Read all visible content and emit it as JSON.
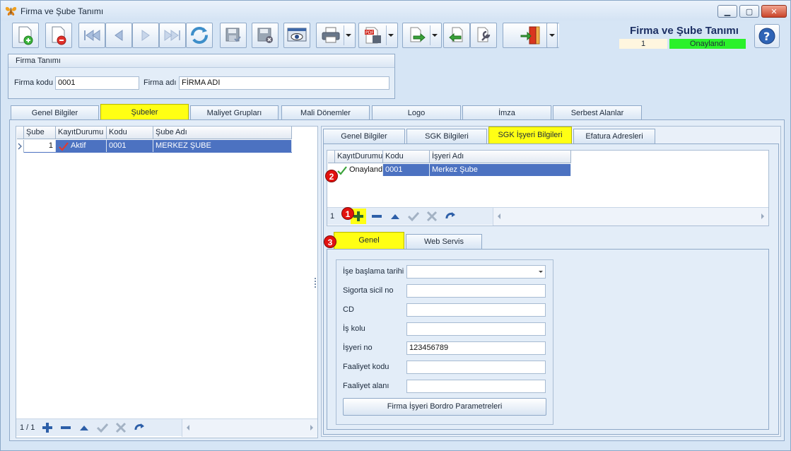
{
  "window": {
    "title": "Firma ve Şube Tanımı",
    "controls": {
      "minimize": "▭",
      "maximize": "▭",
      "close": "✕"
    }
  },
  "toolbar": {
    "buttons": [
      {
        "id": "new",
        "icon": "new-document-icon"
      },
      {
        "id": "delete",
        "icon": "delete-document-icon"
      },
      {
        "id": "first",
        "icon": "first-record-icon"
      },
      {
        "id": "prev",
        "icon": "previous-record-icon"
      },
      {
        "id": "next",
        "icon": "next-record-icon"
      },
      {
        "id": "last",
        "icon": "last-record-icon"
      },
      {
        "id": "refresh",
        "icon": "refresh-icon"
      },
      {
        "id": "save",
        "icon": "save-icon"
      },
      {
        "id": "cancel-save",
        "icon": "save-cancel-icon"
      },
      {
        "id": "preview",
        "icon": "preview-icon"
      },
      {
        "id": "print",
        "icon": "printer-icon"
      },
      {
        "id": "pdf",
        "icon": "pdf-icon"
      },
      {
        "id": "export",
        "icon": "export-icon"
      },
      {
        "id": "import",
        "icon": "import-icon"
      },
      {
        "id": "tools",
        "icon": "tools-icon"
      },
      {
        "id": "exit",
        "icon": "exit-door-icon"
      }
    ]
  },
  "header": {
    "form_title": "Firma ve Şube Tanımı",
    "record_no": "1",
    "status": "Onaylandı",
    "status_color": "#2af12a"
  },
  "firma": {
    "group_title": "Firma Tanımı",
    "code_label": "Firma kodu",
    "code_value": "0001",
    "name_label": "Firma adı",
    "name_value": "FİRMA ADI"
  },
  "main_tabs": [
    {
      "label": "Genel Bilgiler",
      "active": false
    },
    {
      "label": "Şubeler",
      "active": true
    },
    {
      "label": "Maliyet Grupları",
      "active": false
    },
    {
      "label": "Mali Dönemler",
      "active": false
    },
    {
      "label": "Logo",
      "active": false
    },
    {
      "label": "İmza",
      "active": false
    },
    {
      "label": "Serbest Alanlar",
      "active": false
    }
  ],
  "subeler_grid": {
    "columns": [
      "Şube No",
      "KayıtDurumu",
      "Kodu",
      "Şube Adı"
    ],
    "rows": [
      {
        "no": "1",
        "status": "Aktif",
        "code": "0001",
        "name": "MERKEZ ŞUBE"
      }
    ],
    "pager": "1 / 1"
  },
  "sub_tabs": [
    {
      "label": "Genel Bilgiler",
      "active": false
    },
    {
      "label": "SGK Bilgileri",
      "active": false
    },
    {
      "label": "SGK İşyeri Bilgileri",
      "active": true
    },
    {
      "label": "Efatura Adresleri",
      "active": false
    }
  ],
  "isyeri_grid": {
    "columns": [
      "KayıtDurumu",
      "Kodu",
      "İşyeri Adı"
    ],
    "rows": [
      {
        "status": "Onayland",
        "code": "0001",
        "name": "Merkez Şube"
      }
    ],
    "pager": "1"
  },
  "badges": {
    "one": "1",
    "two": "2",
    "three": "3"
  },
  "detail_tabs": [
    {
      "label": "Genel",
      "active": true
    },
    {
      "label": "Web Servis",
      "active": false
    }
  ],
  "detail_form": {
    "fields": [
      {
        "label": "İşe başlama tarihi",
        "value": ""
      },
      {
        "label": "Sigorta sicil no",
        "value": ""
      },
      {
        "label": "CD",
        "value": ""
      },
      {
        "label": "İş kolu",
        "value": ""
      },
      {
        "label": "İşyeri no",
        "value": "123456789"
      },
      {
        "label": "Faaliyet kodu",
        "value": ""
      },
      {
        "label": "Faaliyet alanı",
        "value": ""
      }
    ],
    "bordro_button": "Firma İşyeri Bordro Parametreleri"
  },
  "colors": {
    "accent_yellow": "#ffff14",
    "selection_blue": "#4c72c1",
    "badge_red": "#e2120f"
  }
}
